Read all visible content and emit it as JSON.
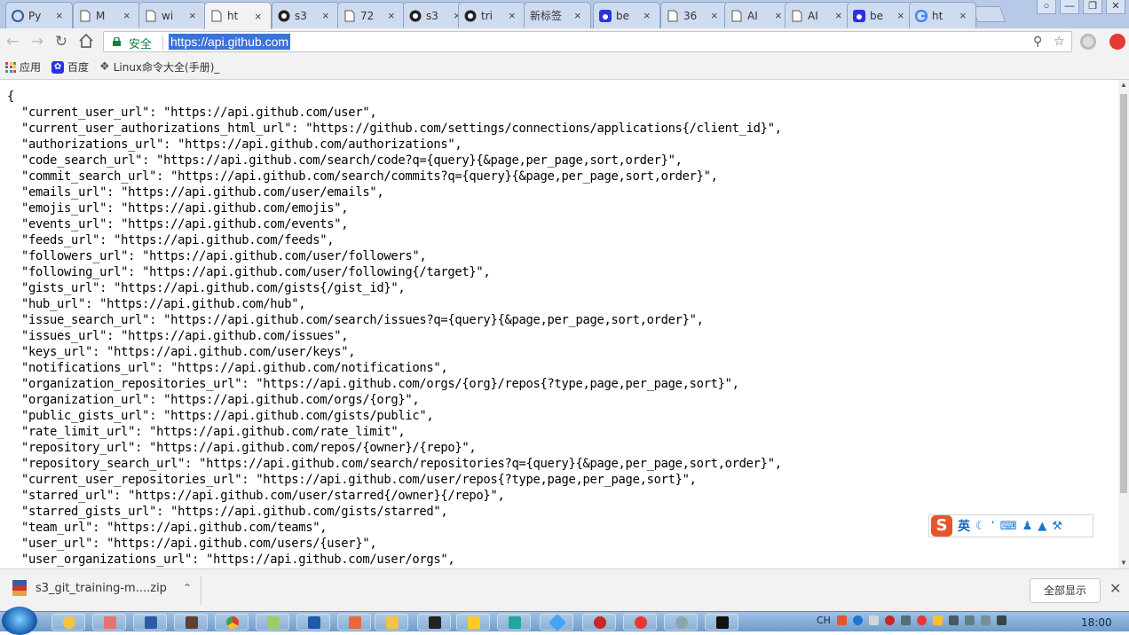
{
  "tabs": [
    {
      "title": "Py",
      "icon": "python-icon"
    },
    {
      "title": "M",
      "icon": "page-icon"
    },
    {
      "title": "wi",
      "icon": "page-icon"
    },
    {
      "title": "ht",
      "icon": "page-icon",
      "active": true
    },
    {
      "title": "s3",
      "icon": "github-icon"
    },
    {
      "title": "72",
      "icon": "page-icon"
    },
    {
      "title": "s3",
      "icon": "github-icon"
    },
    {
      "title": "tri",
      "icon": "github-icon"
    },
    {
      "title": "新标签",
      "icon": "none"
    },
    {
      "title": "be",
      "icon": "baidu-icon"
    },
    {
      "title": "36",
      "icon": "page-icon"
    },
    {
      "title": "AI",
      "icon": "page-icon"
    },
    {
      "title": "AI",
      "icon": "page-icon"
    },
    {
      "title": "be",
      "icon": "baidu-icon"
    },
    {
      "title": "ht",
      "icon": "google-icon"
    }
  ],
  "toolbar": {
    "security_label": "安全",
    "url": "https://api.github.com"
  },
  "bookmarks": {
    "apps_label": "应用",
    "baidu_label": "百度",
    "linux_label": "Linux命令大全(手册)_"
  },
  "json_body": {
    "open_brace": "{",
    "lines": [
      "  \"current_user_url\": \"https://api.github.com/user\",",
      "  \"current_user_authorizations_html_url\": \"https://github.com/settings/connections/applications{/client_id}\",",
      "  \"authorizations_url\": \"https://api.github.com/authorizations\",",
      "  \"code_search_url\": \"https://api.github.com/search/code?q={query}{&page,per_page,sort,order}\",",
      "  \"commit_search_url\": \"https://api.github.com/search/commits?q={query}{&page,per_page,sort,order}\",",
      "  \"emails_url\": \"https://api.github.com/user/emails\",",
      "  \"emojis_url\": \"https://api.github.com/emojis\",",
      "  \"events_url\": \"https://api.github.com/events\",",
      "  \"feeds_url\": \"https://api.github.com/feeds\",",
      "  \"followers_url\": \"https://api.github.com/user/followers\",",
      "  \"following_url\": \"https://api.github.com/user/following{/target}\",",
      "  \"gists_url\": \"https://api.github.com/gists{/gist_id}\",",
      "  \"hub_url\": \"https://api.github.com/hub\",",
      "  \"issue_search_url\": \"https://api.github.com/search/issues?q={query}{&page,per_page,sort,order}\",",
      "  \"issues_url\": \"https://api.github.com/issues\",",
      "  \"keys_url\": \"https://api.github.com/user/keys\",",
      "  \"notifications_url\": \"https://api.github.com/notifications\",",
      "  \"organization_repositories_url\": \"https://api.github.com/orgs/{org}/repos{?type,page,per_page,sort}\",",
      "  \"organization_url\": \"https://api.github.com/orgs/{org}\",",
      "  \"public_gists_url\": \"https://api.github.com/gists/public\",",
      "  \"rate_limit_url\": \"https://api.github.com/rate_limit\",",
      "  \"repository_url\": \"https://api.github.com/repos/{owner}/{repo}\",",
      "  \"repository_search_url\": \"https://api.github.com/search/repositories?q={query}{&page,per_page,sort,order}\",",
      "  \"current_user_repositories_url\": \"https://api.github.com/user/repos{?type,page,per_page,sort}\",",
      "  \"starred_url\": \"https://api.github.com/user/starred{/owner}{/repo}\",",
      "  \"starred_gists_url\": \"https://api.github.com/gists/starred\",",
      "  \"team_url\": \"https://api.github.com/teams\",",
      "  \"user_url\": \"https://api.github.com/users/{user}\",",
      "  \"user_organizations_url\": \"https://api.github.com/user/orgs\","
    ]
  },
  "ime": {
    "logo": "S",
    "mode_label": "英"
  },
  "download": {
    "filename": "s3_git_training-m....zip",
    "show_all_label": "全部显示"
  },
  "taskbar": {
    "lang_label": "CH",
    "clock": "18:00"
  },
  "colors": {
    "accent": "#3b73d7",
    "secure_green": "#0b8043",
    "ime_brand": "#e8542a"
  }
}
